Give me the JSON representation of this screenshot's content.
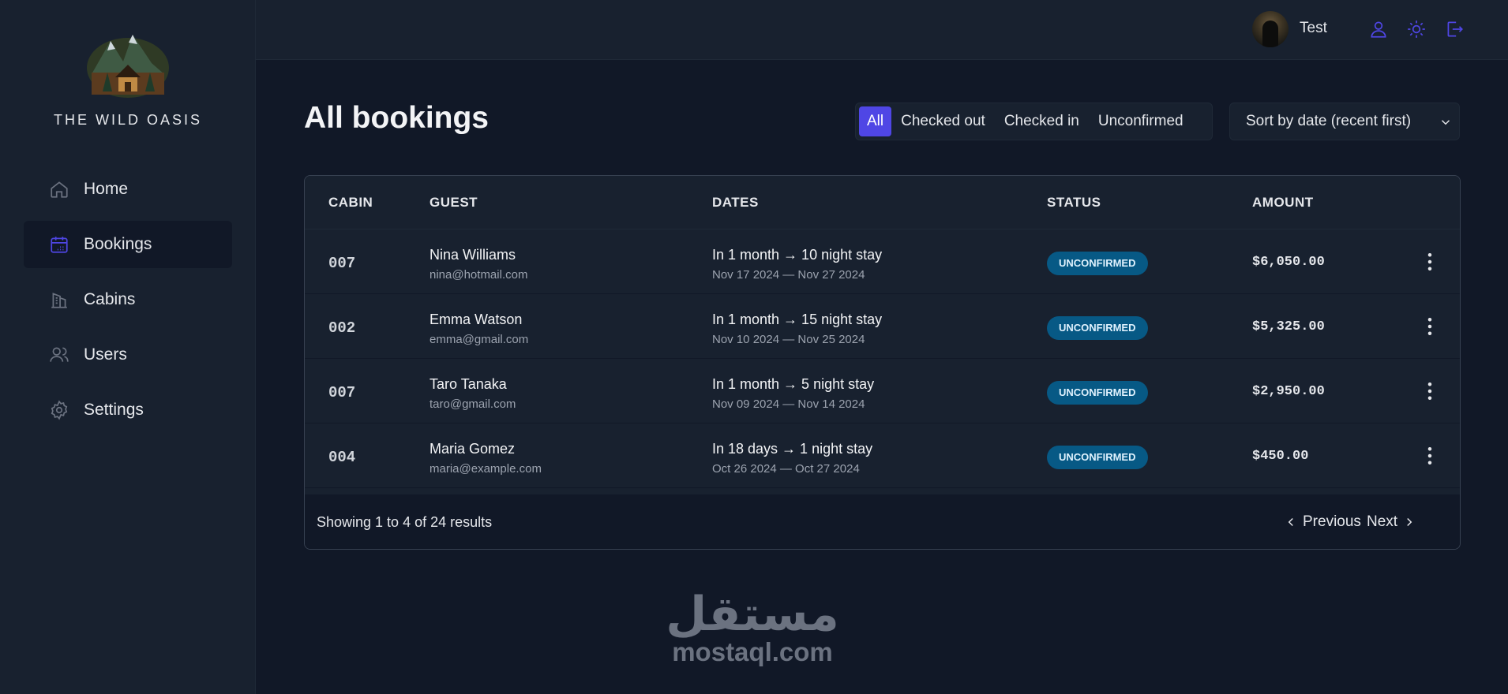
{
  "app": {
    "name": "THE WILD OASIS"
  },
  "sidebar": {
    "items": [
      {
        "label": "Home",
        "icon": "home-icon"
      },
      {
        "label": "Bookings",
        "icon": "calendar-icon",
        "active": true
      },
      {
        "label": "Cabins",
        "icon": "building-icon"
      },
      {
        "label": "Users",
        "icon": "users-icon"
      },
      {
        "label": "Settings",
        "icon": "gear-icon"
      }
    ]
  },
  "header": {
    "user_name": "Test",
    "icons": [
      "user-icon",
      "sun-icon",
      "logout-icon"
    ]
  },
  "main": {
    "title": "All bookings",
    "filters": [
      "All",
      "Checked out",
      "Checked in",
      "Unconfirmed"
    ],
    "active_filter": "All",
    "sort_selected": "Sort by date (recent first)"
  },
  "table": {
    "columns": [
      "CABIN",
      "GUEST",
      "DATES",
      "STATUS",
      "AMOUNT"
    ],
    "rows": [
      {
        "cabin": "007",
        "guest": "Nina Williams",
        "email": "nina@hotmail.com",
        "dates": "In 1 month → 10 night stay",
        "range": "Nov 17 2024 — Nov 27 2024",
        "status": "UNCONFIRMED",
        "amount": "$6,050.00"
      },
      {
        "cabin": "002",
        "guest": "Emma Watson",
        "email": "emma@gmail.com",
        "dates": "In 1 month → 15 night stay",
        "range": "Nov 10 2024 — Nov 25 2024",
        "status": "UNCONFIRMED",
        "amount": "$5,325.00"
      },
      {
        "cabin": "007",
        "guest": "Taro Tanaka",
        "email": "taro@gmail.com",
        "dates": "In 1 month → 5 night stay",
        "range": "Nov 09 2024 — Nov 14 2024",
        "status": "UNCONFIRMED",
        "amount": "$2,950.00"
      },
      {
        "cabin": "004",
        "guest": "Maria Gomez",
        "email": "maria@example.com",
        "dates": "In 18 days → 1 night stay",
        "range": "Oct 26 2024 — Oct 27 2024",
        "status": "UNCONFIRMED",
        "amount": "$450.00"
      }
    ],
    "footer": {
      "showing": "Showing 1 to 4 of 24 results",
      "previous": "Previous",
      "next": "Next"
    }
  },
  "watermark": {
    "arabic": "مستقل",
    "latin": "mostaql.com"
  },
  "colors": {
    "accent": "#4f46e5",
    "badge_bg": "#075985",
    "background": "#111827",
    "panel": "#18212f"
  }
}
